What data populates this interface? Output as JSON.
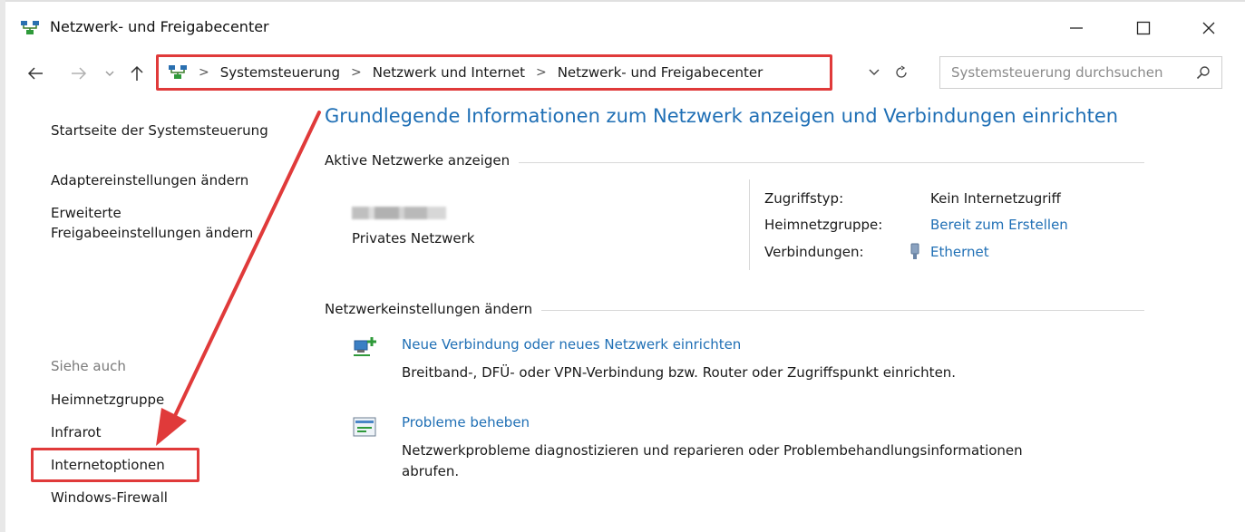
{
  "window": {
    "title": "Netzwerk- und Freigabecenter",
    "controls": {
      "minimize": "—",
      "maximize": "☐",
      "close": "✕"
    }
  },
  "address_bar": {
    "breadcrumb": [
      "Systemsteuerung",
      "Netzwerk und Internet",
      "Netzwerk- und Freigabecenter"
    ],
    "separator": ">",
    "search_placeholder": "Systemsteuerung durchsuchen"
  },
  "sidebar": {
    "home": "Startseite der Systemsteuerung",
    "adapter": "Adaptereinstellungen ändern",
    "advanced_line1": "Erweiterte",
    "advanced_line2": "Freigabeeinstellungen ändern",
    "see_also": "Siehe auch",
    "see_also_items": [
      "Heimnetzgruppe",
      "Infrarot",
      "Internetoptionen",
      "Windows-Firewall"
    ]
  },
  "main": {
    "heading": "Grundlegende Informationen zum Netzwerk anzeigen und Verbindungen einrichten",
    "active_networks_title": "Aktive Netzwerke anzeigen",
    "network": {
      "type": "Privates Netzwerk",
      "access_type_label": "Zugriffstyp:",
      "access_type_value": "Kein Internetzugriff",
      "homegroup_label": "Heimnetzgruppe:",
      "homegroup_value": "Bereit zum Erstellen",
      "connections_label": "Verbindungen:",
      "connections_value": "Ethernet"
    },
    "change_settings_title": "Netzwerkeinstellungen ändern",
    "tasks": [
      {
        "title": "Neue Verbindung oder neues Netzwerk einrichten",
        "description": "Breitband-, DFÜ- oder VPN-Verbindung bzw. Router oder Zugriffspunkt einrichten."
      },
      {
        "title": "Probleme beheben",
        "description_line1": "Netzwerkprobleme diagnostizieren und reparieren oder Problembehandlungsinformationen",
        "description_line2": "abrufen."
      }
    ]
  },
  "colors": {
    "link": "#1f6fb5",
    "annotation": "#e03a3a",
    "text": "#1a1a1a"
  }
}
